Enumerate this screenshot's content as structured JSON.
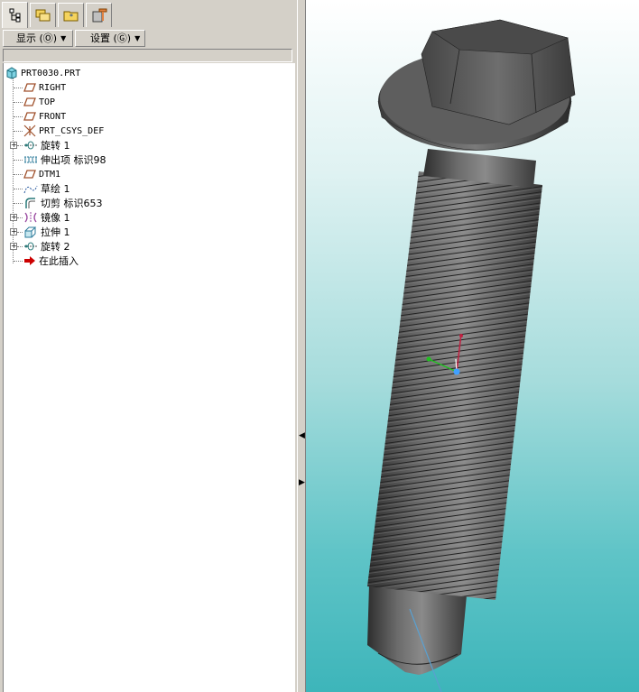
{
  "tabs": [
    {
      "icon": "model-tree-icon",
      "active": true
    },
    {
      "icon": "folder-browser-icon",
      "active": false
    },
    {
      "icon": "favorites-icon",
      "active": false
    },
    {
      "icon": "connections-icon",
      "active": false
    }
  ],
  "toolbar": {
    "show_label": "显示 (Ⓞ)",
    "settings_label": "设置 (Ⓖ)"
  },
  "tree": {
    "root": "PRT0030.PRT",
    "items": [
      {
        "label": "RIGHT",
        "icon": "datum-plane-icon",
        "expandable": false
      },
      {
        "label": "TOP",
        "icon": "datum-plane-icon",
        "expandable": false
      },
      {
        "label": "FRONT",
        "icon": "datum-plane-icon",
        "expandable": false
      },
      {
        "label": "PRT_CSYS_DEF",
        "icon": "csys-icon",
        "expandable": false
      },
      {
        "label": "旋转 1",
        "icon": "revolve-icon",
        "expandable": true
      },
      {
        "label": "伸出项 标识98",
        "icon": "protrusion-icon",
        "expandable": false
      },
      {
        "label": "DTM1",
        "icon": "datum-plane-icon",
        "expandable": false
      },
      {
        "label": "草绘 1",
        "icon": "sketch-icon",
        "expandable": false
      },
      {
        "label": "切剪 标识653",
        "icon": "cut-icon",
        "expandable": false
      },
      {
        "label": "镜像 1",
        "icon": "mirror-icon",
        "expandable": true
      },
      {
        "label": "拉伸 1",
        "icon": "extrude-icon",
        "expandable": true
      },
      {
        "label": "旋转 2",
        "icon": "revolve-icon",
        "expandable": true
      },
      {
        "label": "在此插入",
        "icon": "insert-here-icon",
        "expandable": false
      }
    ]
  },
  "colors": {
    "panel_bg": "#d4d0c8",
    "datum_plane": "#a0522d",
    "insert_arrow": "#cc0000",
    "viewport_top": "#ffffff",
    "viewport_bottom": "#3db5ba",
    "model": "#4a4a4a"
  }
}
